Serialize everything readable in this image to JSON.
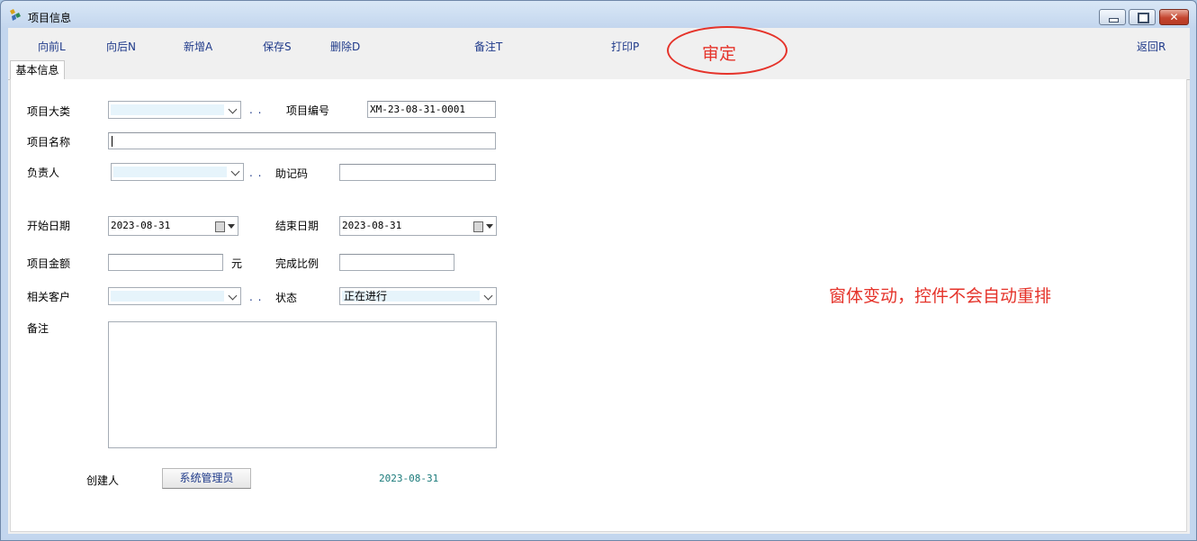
{
  "window": {
    "title": "项目信息"
  },
  "toolbar": {
    "prev": "向前L",
    "next": "向后N",
    "add": "新增A",
    "save": "保存S",
    "delete": "删除D",
    "note": "备注T",
    "print": "打印P",
    "back": "返回R"
  },
  "annotations": {
    "circled": "审定",
    "note": "窗体变动，控件不会自动重排",
    "color": "#e5332a"
  },
  "tabs": [
    {
      "label": "基本信息"
    }
  ],
  "form": {
    "category_label": "项目大类",
    "category_value": "",
    "code_label": "项目编号",
    "code_value": "XM-23-08-31-0001",
    "name_label": "项目名称",
    "name_value": "",
    "owner_label": "负责人",
    "owner_value": "",
    "mnemonic_label": "助记码",
    "mnemonic_value": "",
    "start_label": "开始日期",
    "start_value": "2023-08-31",
    "end_label": "结束日期",
    "end_value": "2023-08-31",
    "amount_label": "项目金额",
    "amount_value": "",
    "amount_unit": "元",
    "progress_label": "完成比例",
    "progress_value": "",
    "customer_label": "相关客户",
    "customer_value": "",
    "status_label": "状态",
    "status_value": "正在进行",
    "remark_label": "备注",
    "remark_value": "",
    "ellipsis": ". .",
    "creator_label": "创建人",
    "creator_value": "系统管理员",
    "created_date": "2023-08-31"
  },
  "colors": {
    "link": "#1f3a8a",
    "combo_fill": "#e6f4fb",
    "date_text": "#1a7a7a"
  },
  "icons": [
    "app-icon",
    "minimize-icon",
    "maximize-icon",
    "close-icon",
    "calendar-icon",
    "chevron-down-icon"
  ]
}
